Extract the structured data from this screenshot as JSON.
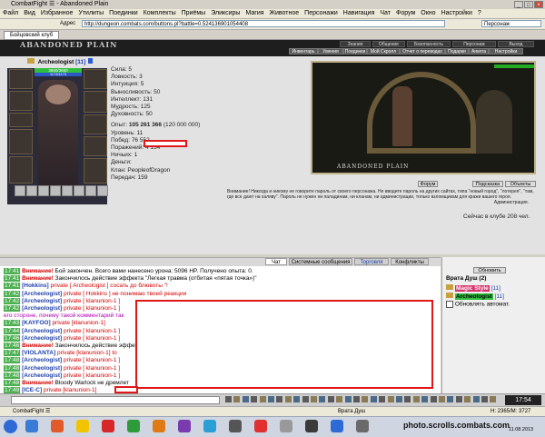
{
  "window": {
    "title": "CombatFight ☰ - Abandoned Plain",
    "buttons": [
      "_",
      "□",
      "×"
    ]
  },
  "menu": [
    "Файл",
    "Вид",
    "Избранное",
    "Утилиты",
    "Поединки",
    "Комплекты",
    "Приёмы",
    "Эликсиры",
    "Магия",
    "Животное",
    "Персонажи",
    "Навигация",
    "Чат",
    "Форум",
    "Окно",
    "Настройки",
    "?"
  ],
  "address": {
    "label": "Адрес",
    "url": "http://dungeon.combats.com/buttons.pl?battle=0.524136901054408",
    "search": "Персонаж"
  },
  "browser_tab": "Бойцовский клуб",
  "game": {
    "logo": "ABANDONED PLAIN",
    "nav_top": [
      "Знания",
      "Общение",
      "Безопасность",
      "Персонаж",
      "Выход"
    ],
    "nav_bottom": [
      "Инвентарь",
      "Умения",
      "Поединки",
      "Мой Скролл",
      "Отчет о переводах",
      "Подарки",
      "Анкета",
      "Настройки"
    ]
  },
  "character": {
    "name": "Archeologist",
    "level": "[11]",
    "hp": "3660/3660",
    "mana": "1173/1173",
    "stats": [
      {
        "label": "Сила:",
        "value": "5"
      },
      {
        "label": "Ловкость:",
        "value": "3"
      },
      {
        "label": "Интуиция:",
        "value": "5"
      },
      {
        "label": "Выносливость:",
        "value": "50"
      },
      {
        "label": "Интеллект:",
        "value": "131"
      },
      {
        "label": "Мудрость:",
        "value": "125"
      },
      {
        "label": "Духовность:",
        "value": "50"
      }
    ],
    "exp_label": "Опыт:",
    "exp_value": "105 261 366",
    "exp_next": "(120 000 000)",
    "info": [
      "Уровень: 11",
      "Побед: 76 552",
      "Поражений: 4 154",
      "Ничьих: 1",
      "Деньги:",
      "Клан: PeopleofDragon",
      "Передач: 159"
    ]
  },
  "scene": {
    "label": "ABANDONED PLAIN"
  },
  "scene_buttons": [
    "Форум",
    "Подсказка",
    "Объекты"
  ],
  "warning": {
    "text": "Внимание! Никогда и никому не говорите пароль от своего персонажа. Не вводите пароль на других сайтах, типа \"новый город\", \"лотерея\", \"там, где все дают на халяву\". Пароль не нужен ни паладинам, ни кланам, ни администрации, только взломщикам для кражи вашего героя.",
    "sign": "Администрация."
  },
  "online": "Сейчас в клубе 208 чел.",
  "chat_tabs": [
    "Чат",
    "Системные сообщения",
    "Торговля",
    "Конфликты"
  ],
  "chat": [
    {
      "time": "17:41",
      "who": "Внимание!",
      "text": " Бой закончен. Всего вами нанесено урона: 5096 HP. Получено опыта: 0.",
      "kind": "sys"
    },
    {
      "time": "17:41",
      "who": "Внимание!",
      "text": " Закончилось действие эффекта \"Легкая травма (отбитая «пятая точка»)\"",
      "kind": "sys"
    },
    {
      "time": "17:41",
      "who": "[Hokkins]",
      "text": " private [ Archeologist ] сосать до блювоты \"!",
      "kind": "priv"
    },
    {
      "time": "17:42",
      "who": "[Archeologist]",
      "text": " private [ Hokkins ] не понимаю твоей реакции",
      "kind": "priv"
    },
    {
      "time": "17:42",
      "who": "[Archeologist]",
      "text": " private [ klanunion-1 ]",
      "kind": "priv"
    },
    {
      "time": "17:42",
      "who": "[Archeologist]",
      "text": " private [ klanunion-1 ]",
      "kind": "priv"
    },
    {
      "time": "",
      "who": "",
      "text": "его стороне, почему такой комментарий так",
      "kind": "cont"
    },
    {
      "time": "17:43",
      "who": "[KAYFOO]",
      "text": " private [klanunion-1]",
      "kind": "priv"
    },
    {
      "time": "17:44",
      "who": "[Archeologist]",
      "text": " private [ klanunion-1 ]",
      "kind": "priv"
    },
    {
      "time": "17:46",
      "who": "[Archeologist]",
      "text": " private [ klanunion-1 ]",
      "kind": "priv"
    },
    {
      "time": "17:46",
      "who": "Внимание!",
      "text": " Закончилось действие эффекта",
      "kind": "sys"
    },
    {
      "time": "17:47",
      "who": "[VIOLANTA]",
      "text": " private [klanunion-1] to",
      "kind": "priv"
    },
    {
      "time": "17:48",
      "who": "[Archeologist]",
      "text": " private [ klanunion-1 ]",
      "kind": "priv"
    },
    {
      "time": "17:48",
      "who": "[Archeologist]",
      "text": " private [ klanunion-1 ]",
      "kind": "priv"
    },
    {
      "time": "17:48",
      "who": "[Archeologist]",
      "text": " private [ klanunion-1 ]",
      "kind": "priv"
    },
    {
      "time": "17:48",
      "who": "Внимание!",
      "text": " Bloody Warlock не дремлет",
      "kind": "sys"
    },
    {
      "time": "17:49",
      "who": "[ICE-C]",
      "text": " private [klanunion-1]",
      "kind": "priv"
    }
  ],
  "room": {
    "refresh": "Обновить",
    "title": "Врата Душ (2)",
    "users": [
      {
        "name": "Magic Style",
        "level": "[11]"
      },
      {
        "name": "Archeologist",
        "level": "[11]"
      }
    ],
    "auto": "Обновлять автомат."
  },
  "chat_clock": "17:54",
  "statusbar": {
    "left": "CombatFight ☰",
    "center": "Врата Душ",
    "right": "Н: 2365/М: 3727"
  },
  "taskbar": {
    "watermark": "photo.scrolls.combats.com",
    "time": "17:54",
    "date": "11.08.2013"
  },
  "colors": {
    "header": "#1e1e1e",
    "private_red": "#d00000",
    "nick_blue": "#1c3ea8",
    "timestamp_green": "#4caf50"
  }
}
